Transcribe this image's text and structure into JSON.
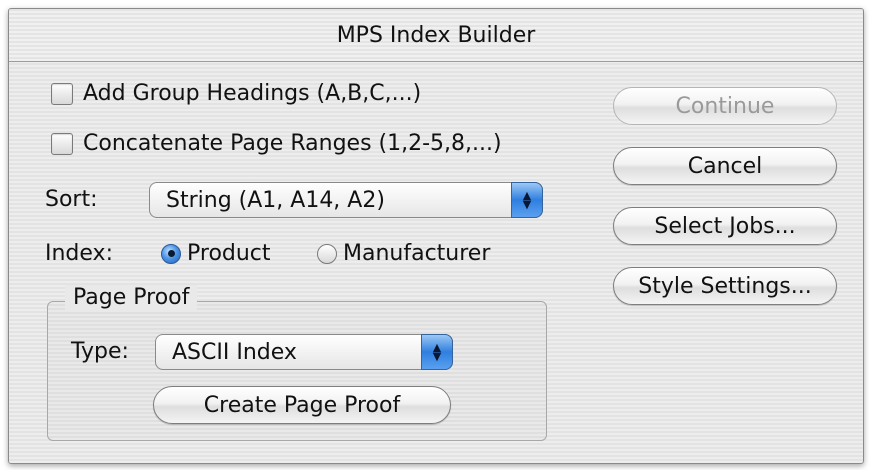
{
  "window": {
    "title": "MPS Index Builder"
  },
  "options": {
    "group_headings": {
      "label": "Add Group Headings (A,B,C,...)",
      "checked": false
    },
    "concatenate": {
      "label": "Concatenate Page Ranges (1,2-5,8,...)",
      "checked": false
    }
  },
  "sort": {
    "label": "Sort:",
    "value": "String (A1, A14, A2)"
  },
  "index": {
    "label": "Index:",
    "options": [
      {
        "label": "Product",
        "selected": true
      },
      {
        "label": "Manufacturer",
        "selected": false
      }
    ]
  },
  "page_proof": {
    "title": "Page Proof",
    "type_label": "Type:",
    "type_value": "ASCII Index",
    "create_button": "Create Page Proof"
  },
  "buttons": {
    "continue": "Continue",
    "cancel": "Cancel",
    "select_jobs": "Select Jobs...",
    "style_settings": "Style Settings..."
  },
  "colors": {
    "accent": "#2f7fe0"
  }
}
